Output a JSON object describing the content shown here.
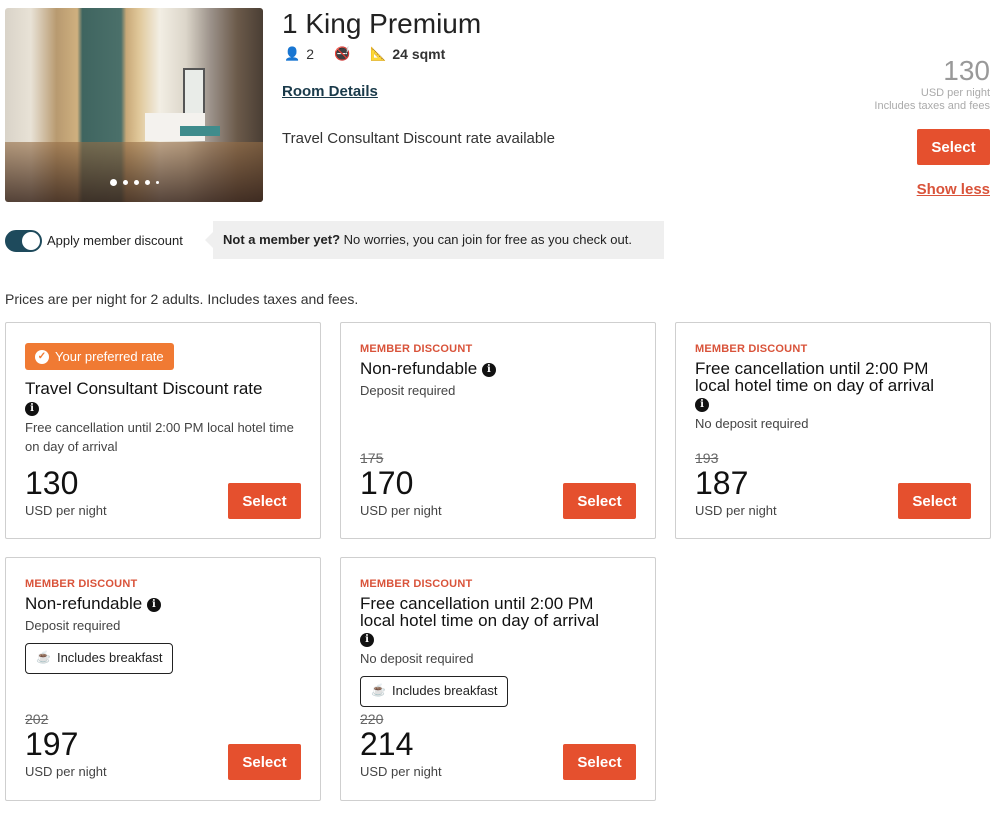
{
  "room": {
    "title": "1 King Premium",
    "guests": "2",
    "size": "24 sqmt",
    "details_link": "Room Details",
    "rate_note": "Travel Consultant Discount rate available",
    "icons": [
      "person-icon",
      "no-smoking-icon",
      "room-size-icon"
    ],
    "photo_dots": 5,
    "photo_active": 1
  },
  "summary": {
    "price": "130",
    "unit": "USD per night",
    "taxes": "Includes taxes and fees",
    "select_label": "Select",
    "show_less": "Show less"
  },
  "member": {
    "toggle_label": "Apply member discount",
    "toggle_on": true,
    "tooltip_bold": "Not a member yet?",
    "tooltip_text": " No worries, you can join for free as you check out."
  },
  "prices_note": "Prices are per night for 2 adults. Includes taxes and fees.",
  "colors": {
    "accent": "#e5502e",
    "preferred_badge": "#f07a33",
    "member_tag": "#d9533a",
    "toggle": "#1e4a5c"
  },
  "rates": [
    {
      "badge": "Your preferred rate",
      "title": "Travel Consultant Discount rate",
      "desc": "Free cancellation until 2:00 PM local hotel time on day of arrival",
      "price": "130",
      "unit": "USD per night",
      "select": "Select"
    },
    {
      "tag": "MEMBER DISCOUNT",
      "title": "Non-refundable",
      "desc": "Deposit required",
      "old_price": "175",
      "price": "170",
      "unit": "USD per night",
      "select": "Select"
    },
    {
      "tag": "MEMBER DISCOUNT",
      "title": "Free cancellation until 2:00 PM local hotel time on day of arrival",
      "desc": "No deposit required",
      "old_price": "193",
      "price": "187",
      "unit": "USD per night",
      "select": "Select"
    },
    {
      "tag": "MEMBER DISCOUNT",
      "title": "Non-refundable",
      "desc": "Deposit required",
      "amenity": "Includes breakfast",
      "old_price": "202",
      "price": "197",
      "unit": "USD per night",
      "select": "Select"
    },
    {
      "tag": "MEMBER DISCOUNT",
      "title": "Free cancellation until 2:00 PM local hotel time on day of arrival",
      "desc": "No deposit required",
      "amenity": "Includes breakfast",
      "old_price": "220",
      "price": "214",
      "unit": "USD per night",
      "select": "Select"
    }
  ]
}
